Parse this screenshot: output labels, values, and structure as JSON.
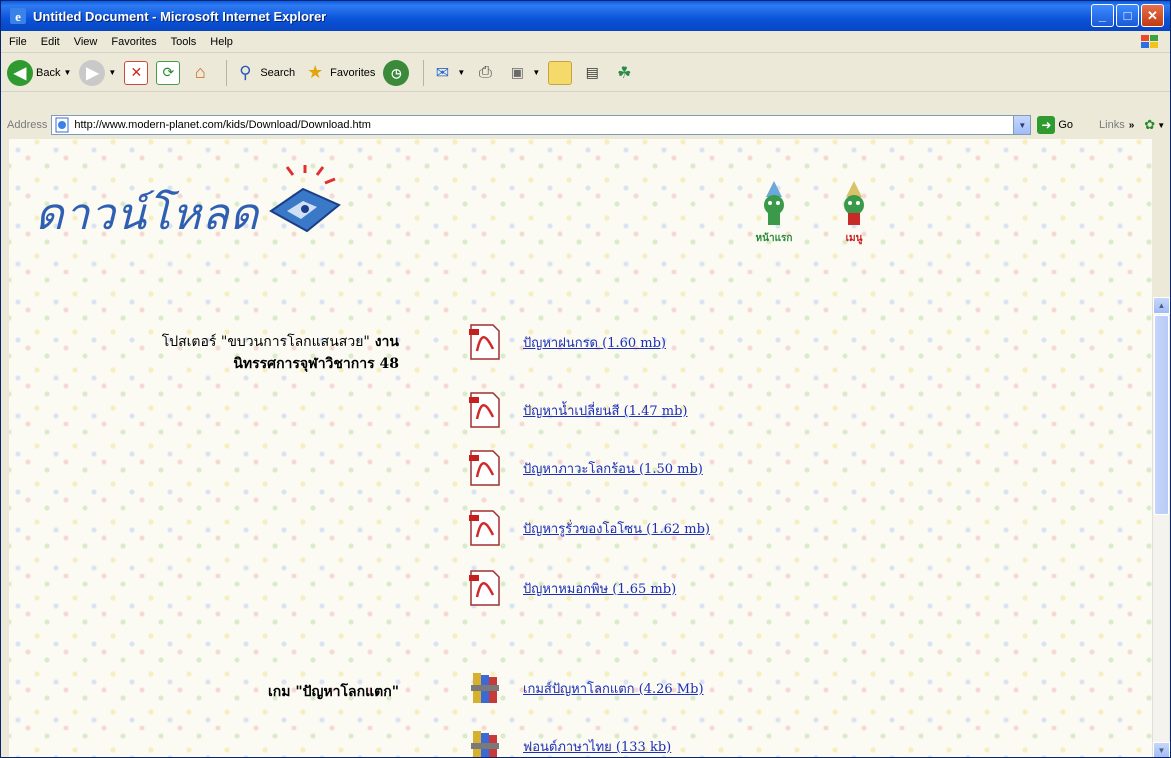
{
  "window": {
    "title": "Untitled Document - Microsoft Internet Explorer"
  },
  "menu": [
    "File",
    "Edit",
    "View",
    "Favorites",
    "Tools",
    "Help"
  ],
  "toolbar": {
    "back": "Back",
    "search": "Search",
    "favorites": "Favorites"
  },
  "address": {
    "label": "Address",
    "url": "http://www.modern-planet.com/kids/Download/Download.htm",
    "go": "Go",
    "links": "Links"
  },
  "page": {
    "title": "ดาวน์โหลด",
    "nav": [
      {
        "label": "หน้าแรก",
        "color": "#2a8a3a"
      },
      {
        "label": "เมนู",
        "color": "#c81e1e"
      }
    ],
    "poster_heading": {
      "prefix": "โปสเตอร์ \"ขบวนการโลกแสนสวย\"",
      "bold1": " งาน",
      "bold2": "นิทรรศการจุฬาวิชาการ 48"
    },
    "pdf_links": [
      "ปัญหาฝนกรด (1.60 mb)",
      "ปัญหาน้ำเปลี่ยนสี (1.47 mb)",
      "ปัญหาภาวะโลกร้อน (1.50 mb)",
      "ปัญหารูรั่วของโอโซน (1.62 mb)",
      "ปัญหาหมอกพิษ (1.65 mb)"
    ],
    "game_heading": "เกม \"ปัญหาโลกแตก\"",
    "game_links": [
      "เกมส์ปัญหาโลกแตก (4.26 Mb)",
      "ฟอนต์ภาษาไทย (133 kb)"
    ]
  }
}
